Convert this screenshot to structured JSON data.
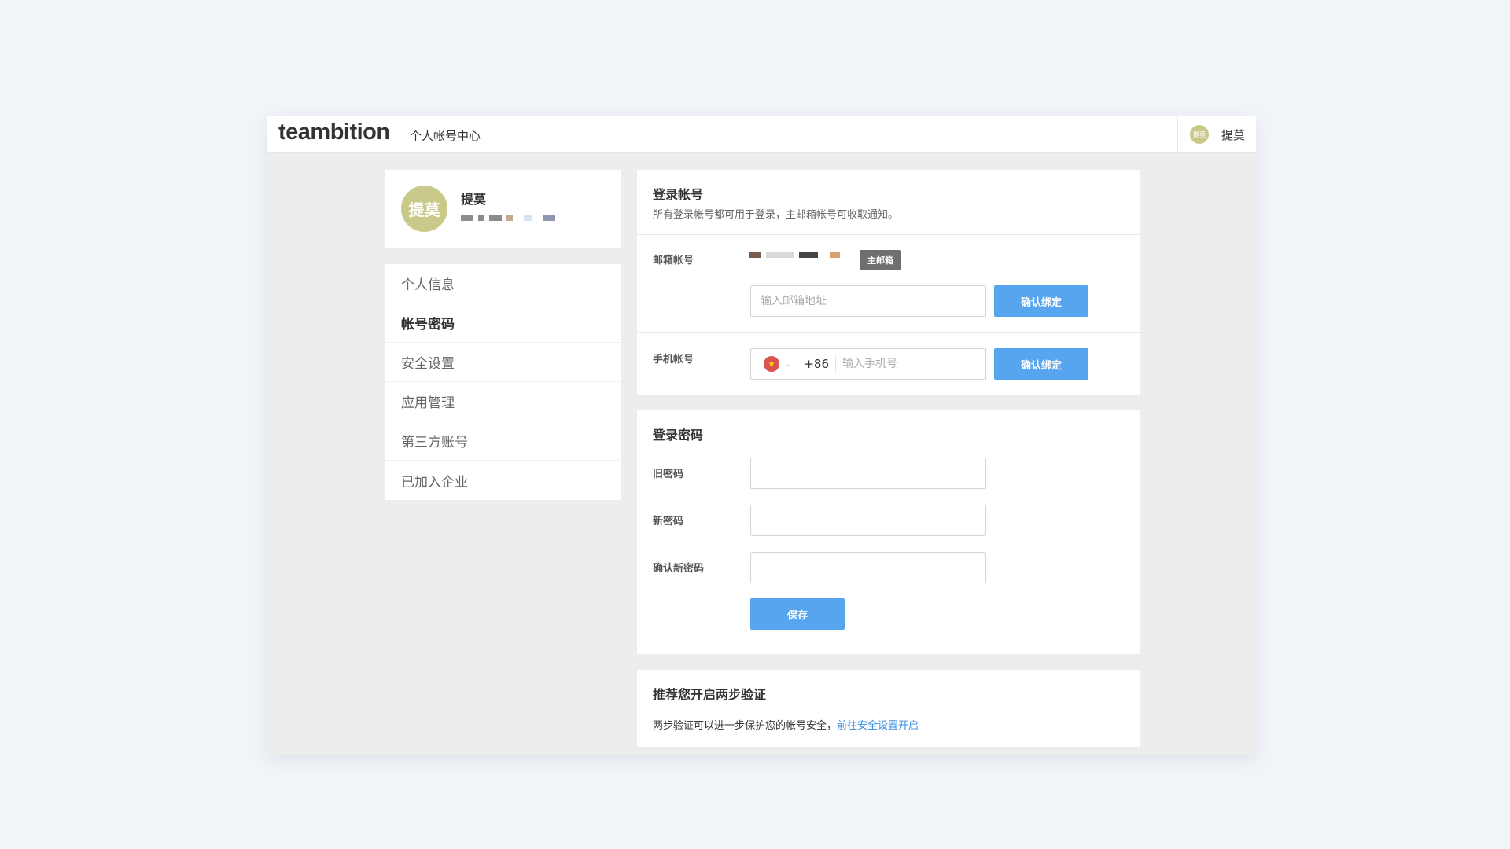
{
  "header": {
    "logo": "teambition",
    "subtitle": "个人帐号中心",
    "user_avatar_text": "提莫",
    "user_name": "提莫"
  },
  "profile": {
    "avatar_text": "提莫",
    "name": "提莫"
  },
  "sidebar": {
    "items": [
      {
        "label": "个人信息"
      },
      {
        "label": "帐号密码"
      },
      {
        "label": "安全设置"
      },
      {
        "label": "应用管理"
      },
      {
        "label": "第三方账号"
      },
      {
        "label": "已加入企业"
      }
    ],
    "active_index": 1
  },
  "login_account": {
    "title": "登录帐号",
    "description": "所有登录帐号都可用于登录，主邮箱帐号可收取通知。",
    "email_label": "邮箱帐号",
    "primary_badge": "主邮箱",
    "email_placeholder": "输入邮箱地址",
    "email_bind_button": "确认绑定",
    "phone_label": "手机帐号",
    "phone_country_code": "+86",
    "phone_placeholder": "输入手机号",
    "phone_bind_button": "确认绑定",
    "flag_icon": "china-flag-icon"
  },
  "login_password": {
    "title": "登录密码",
    "old_password_label": "旧密码",
    "new_password_label": "新密码",
    "confirm_password_label": "确认新密码",
    "save_button": "保存"
  },
  "two_factor": {
    "title": "推荐您开启两步验证",
    "text": "两步验证可以进一步保护您的帐号安全，",
    "link_text": "前往安全设置开启"
  },
  "colors": {
    "primary_button": "#58a5ef",
    "link": "#3a8ee6",
    "avatar": "#c9c98a",
    "badge": "#6f6f6f"
  }
}
